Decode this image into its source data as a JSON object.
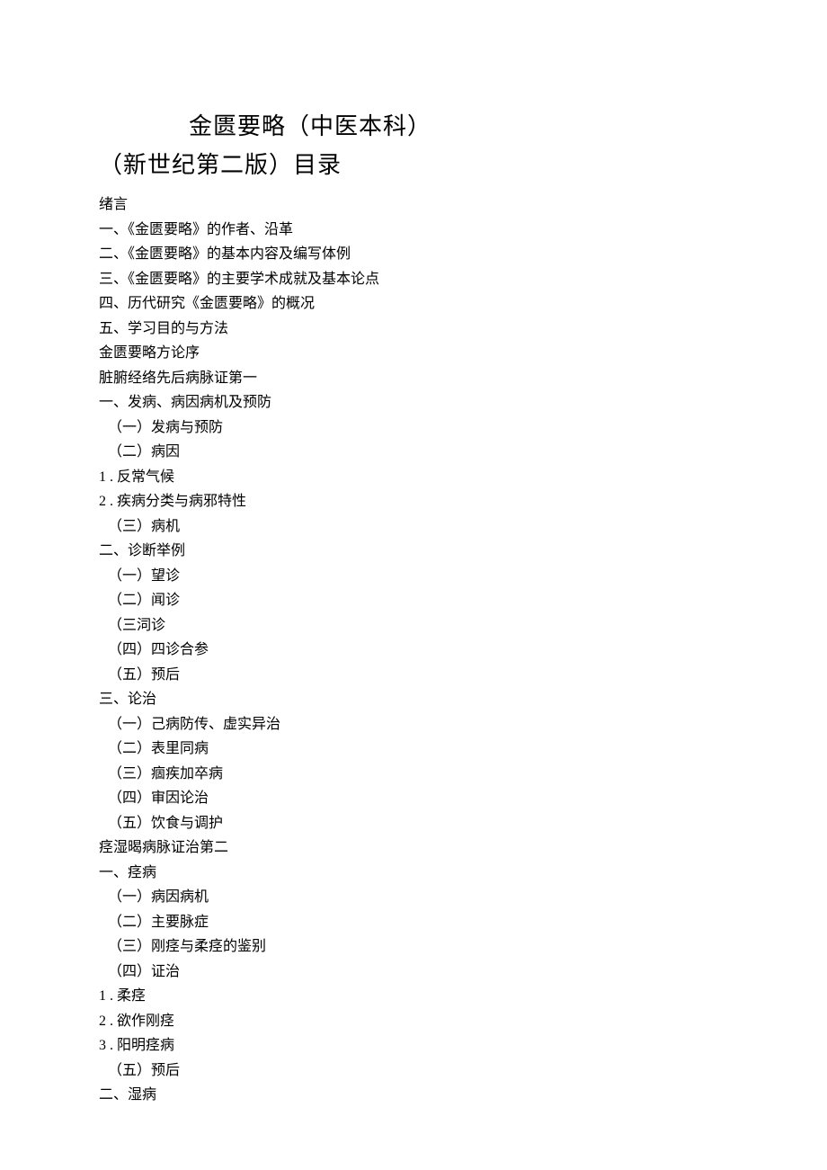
{
  "title": {
    "line1": "金匮要略（中医本科）",
    "line2": "（新世纪第二版）目录"
  },
  "toc": [
    {
      "text": "绪言",
      "indent": 0
    },
    {
      "text": "一、《金匮要略》的作者、沿革",
      "indent": 0
    },
    {
      "text": "二、《金匮要略》的基本内容及编写体例",
      "indent": 0
    },
    {
      "text": "三、《金匮要略》的主要学术成就及基本论点",
      "indent": 0
    },
    {
      "text": "四、历代研究《金匮要略》的概况",
      "indent": 0
    },
    {
      "text": "五、学习目的与方法",
      "indent": 0
    },
    {
      "text": "金匮要略方论序",
      "indent": 0
    },
    {
      "text": "脏腑经络先后病脉证第一",
      "indent": 0
    },
    {
      "text": "一、发病、病因病机及预防",
      "indent": 0
    },
    {
      "text": "（一）发病与预防",
      "indent": 1
    },
    {
      "text": "（二）病因",
      "indent": 1
    },
    {
      "text": "1 . 反常气候",
      "indent": 0
    },
    {
      "text": "2  . 疾病分类与病邪特性",
      "indent": 0
    },
    {
      "text": "（三）病机",
      "indent": 1
    },
    {
      "text": "二、诊断举例",
      "indent": 0
    },
    {
      "text": "（一）望诊",
      "indent": 1
    },
    {
      "text": "（二）闻诊",
      "indent": 1
    },
    {
      "text": "（三泀诊",
      "indent": 1
    },
    {
      "text": "（四）四诊合参",
      "indent": 1
    },
    {
      "text": "（五）预后",
      "indent": 1
    },
    {
      "text": "三、论治",
      "indent": 0
    },
    {
      "text": "（一）己病防传、虚实异治",
      "indent": 1
    },
    {
      "text": "（二）表里同病",
      "indent": 1
    },
    {
      "text": "（三）痼疾加卒病",
      "indent": 1
    },
    {
      "text": "（四）审因论治",
      "indent": 1
    },
    {
      "text": "（五）饮食与调护",
      "indent": 1
    },
    {
      "text": "痉湿暍病脉证治第二",
      "indent": 0
    },
    {
      "text": "一、痉病",
      "indent": 0
    },
    {
      "text": "（一）病因病机",
      "indent": 1
    },
    {
      "text": "（二）主要脉症",
      "indent": 1
    },
    {
      "text": "（三）刚痉与柔痉的鉴别",
      "indent": 1
    },
    {
      "text": "（四）证治",
      "indent": 1
    },
    {
      "text": "1  . 柔痉",
      "indent": 0
    },
    {
      "text": "2   . 欲作刚痉",
      "indent": 0
    },
    {
      "text": "3   . 阳明痉病",
      "indent": 0
    },
    {
      "text": "（五）预后",
      "indent": 1
    },
    {
      "text": "二、湿病",
      "indent": 0
    }
  ]
}
